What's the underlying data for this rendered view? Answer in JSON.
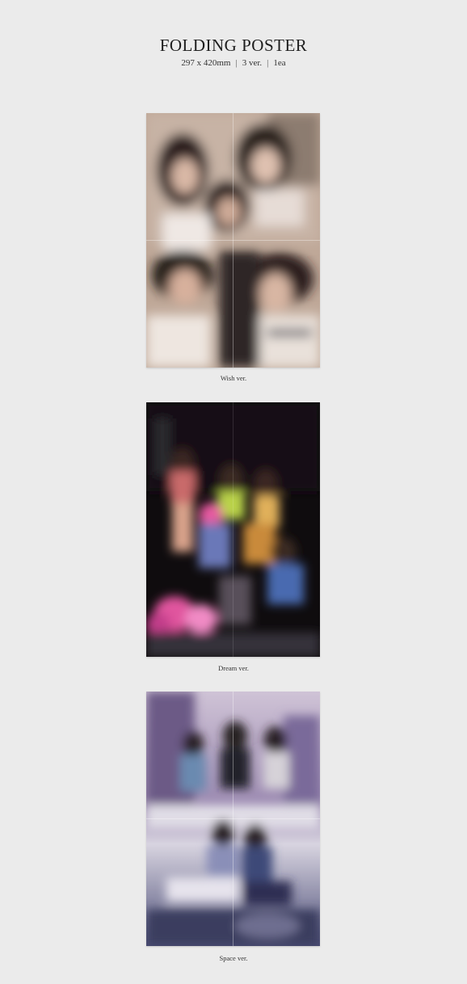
{
  "header": {
    "title": "FOLDING POSTER",
    "size": "297 x 420mm",
    "versions": "3 ver.",
    "quantity": "1ea",
    "separator": "|"
  },
  "posters": [
    {
      "caption": "Wish ver."
    },
    {
      "caption": "Dream ver."
    },
    {
      "caption": "Space ver."
    }
  ]
}
